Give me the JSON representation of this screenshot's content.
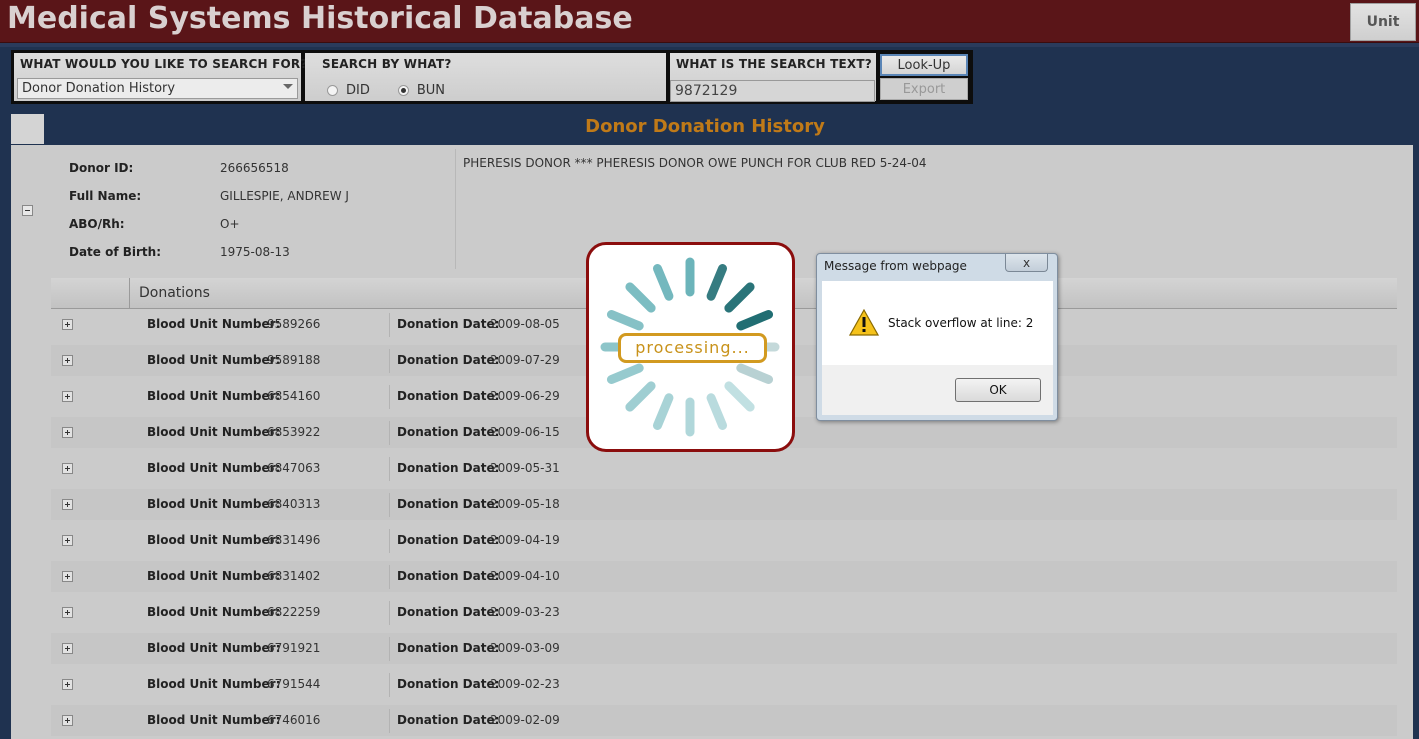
{
  "header": {
    "title": "Medical Systems Historical Database",
    "unit_label": "Unit"
  },
  "search": {
    "what_label": "WHAT WOULD YOU LIKE TO SEARCH FOR?",
    "what_value": "Donor Donation History",
    "by_label": "SEARCH BY WHAT?",
    "options": [
      "DID",
      "BUN"
    ],
    "selected_option": "BUN",
    "text_label": "WHAT IS THE SEARCH TEXT?",
    "text_value": "9872129",
    "lookup_label": "Look-Up",
    "export_label": "Export"
  },
  "section": {
    "title": "Donor Donation History"
  },
  "donor": {
    "fields": [
      {
        "label": "Donor ID:",
        "value": "266656518"
      },
      {
        "label": "Full Name:",
        "value": "GILLESPIE, ANDREW J"
      },
      {
        "label": "ABO/Rh:",
        "value": "O+"
      },
      {
        "label": "Date of Birth:",
        "value": "1975-08-13"
      }
    ],
    "note": "PHERESIS DONOR *** PHERESIS DONOR OWE PUNCH FOR CLUB RED 5-24-04"
  },
  "donations": {
    "title": "Donations",
    "bun_label": "Blood Unit Number:",
    "date_label": "Donation Date:",
    "rows": [
      {
        "bun": "9589266",
        "date": "2009-08-05"
      },
      {
        "bun": "9589188",
        "date": "2009-07-29"
      },
      {
        "bun": "6854160",
        "date": "2009-06-29"
      },
      {
        "bun": "6853922",
        "date": "2009-06-15"
      },
      {
        "bun": "6847063",
        "date": "2009-05-31"
      },
      {
        "bun": "6840313",
        "date": "2009-05-18"
      },
      {
        "bun": "6831496",
        "date": "2009-04-19"
      },
      {
        "bun": "6831402",
        "date": "2009-04-10"
      },
      {
        "bun": "6822259",
        "date": "2009-03-23"
      },
      {
        "bun": "6791921",
        "date": "2009-03-09"
      },
      {
        "bun": "6791544",
        "date": "2009-02-23"
      },
      {
        "bun": "6746016",
        "date": "2009-02-09"
      }
    ]
  },
  "processing": {
    "label": "processing..."
  },
  "dialog": {
    "title": "Message from webpage",
    "close_glyph": "x",
    "message": "Stack overflow at line: 2",
    "ok_label": "OK",
    "icon": "warning-icon"
  },
  "colors": {
    "header_bg": "#5a1518",
    "page_bg": "#1f3250",
    "section_title": "#c07a18",
    "processing_border": "#8b0d0d",
    "spinner": "#1f7f86"
  }
}
